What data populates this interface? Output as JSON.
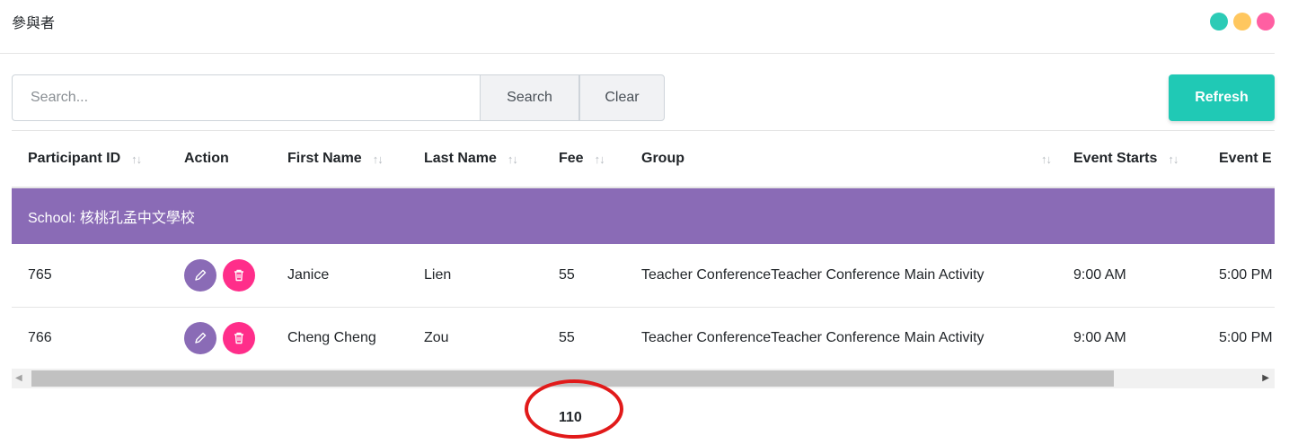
{
  "page": {
    "title": "參與者"
  },
  "window_dots": [
    "#2ccbb6",
    "#ffc75f",
    "#ff5fa2"
  ],
  "search": {
    "placeholder": "Search...",
    "value": "",
    "search_label": "Search",
    "clear_label": "Clear"
  },
  "refresh_label": "Refresh",
  "table": {
    "headers": {
      "participant_id": "Participant ID",
      "action": "Action",
      "first_name": "First Name",
      "last_name": "Last Name",
      "fee": "Fee",
      "group": "Group",
      "event_starts": "Event Starts",
      "event_ends": "Event E"
    },
    "group_label": "School: 核桃孔孟中文學校",
    "rows": [
      {
        "id": "765",
        "first": "Janice",
        "last": "Lien",
        "fee": "55",
        "group": "Teacher ConferenceTeacher Conference Main Activity",
        "start": "9:00 AM",
        "end": "5:00 PM"
      },
      {
        "id": "766",
        "first": "Cheng Cheng",
        "last": "Zou",
        "fee": "55",
        "group": "Teacher ConferenceTeacher Conference Main Activity",
        "start": "9:00 AM",
        "end": "5:00 PM"
      }
    ]
  },
  "footer": {
    "total": "110"
  },
  "colors": {
    "accent": "#20c9b5",
    "group_row": "#8a6bb6",
    "edit_button": "#8a6bb6",
    "delete_button": "#ff2e8a",
    "highlight_circle": "#e11a1a"
  }
}
